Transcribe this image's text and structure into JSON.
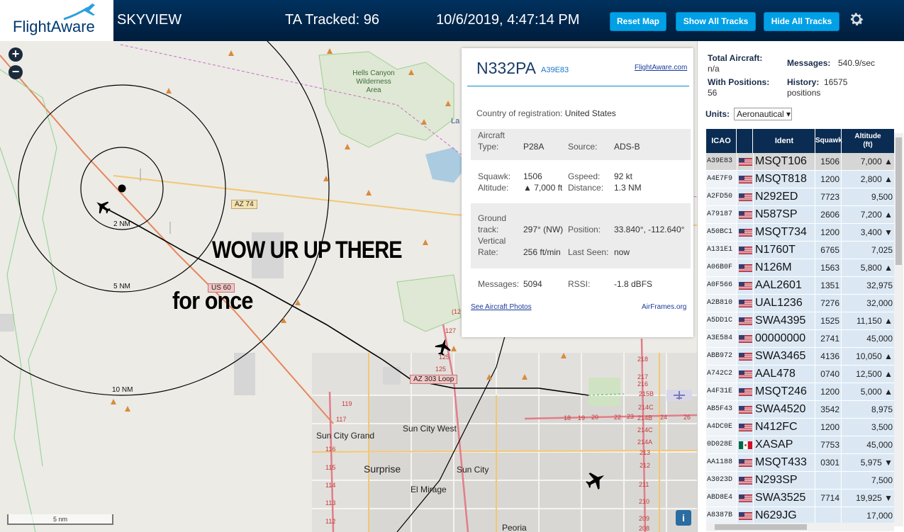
{
  "header": {
    "logo_text": "FlightAware",
    "title": "SKYVIEW",
    "tracked": "TA Tracked: 96",
    "datetime": "10/6/2019, 4:47:14 PM",
    "reset_label": "Reset Map",
    "show_label": "Show All Tracks",
    "hide_label": "Hide All Tracks",
    "settings_icon": "gear-icon"
  },
  "map": {
    "zoom_in": "+",
    "zoom_out": "−",
    "place_labels": {
      "hells_canyon": "Hells Canyon Wilderness Area",
      "lake": "La",
      "sun_city_grand": "Sun City Grand",
      "sun_city_west": "Sun City West",
      "surprise": "Surprise",
      "sun_city": "Sun City",
      "el_mirage": "El Mirage",
      "peoria": "Peoria"
    },
    "ring_labels": [
      "2 NM",
      "5 NM",
      "10 NM"
    ],
    "road_labels": {
      "az74": "AZ 74",
      "us60": "US 60",
      "az303": "AZ 303 Loop"
    },
    "highway_numbers": [
      "(12",
      "127",
      "125",
      "125",
      "119",
      "117",
      "116",
      "115",
      "114",
      "113",
      "112",
      "218",
      "217",
      "216",
      "215B",
      "214C",
      "214B",
      "214C",
      "214A",
      "213",
      "212",
      "211",
      "210",
      "209",
      "208",
      "18",
      "19",
      "20",
      "22",
      "23",
      "24",
      "26"
    ],
    "meme_line1": "WOW UR UP THERE",
    "meme_line2": "for once",
    "scale": "5 nm",
    "info": "i"
  },
  "detail": {
    "ident": "N332PA",
    "icao": "A39E83",
    "fa_link": "FlightAware.com",
    "country_label": "Country of registration:",
    "country_value": "United States",
    "aircraft_type_label1": "Aircraft",
    "aircraft_type_label2": "Type:",
    "aircraft_type": "P28A",
    "source_label": "Source:",
    "source": "ADS-B",
    "squawk_label": "Squawk:",
    "squawk": "1506",
    "altitude_label": "Altitude:",
    "altitude": "▲ 7,000 ft",
    "gspeed_label": "Gspeed:",
    "gspeed": "92 kt",
    "distance_label": "Distance:",
    "distance": "1.3 NM",
    "track_label1": "Ground",
    "track_label2": "track:",
    "track": "297° (NW)",
    "position_label": "Position:",
    "position": "33.840°, -112.640°",
    "vrate_label1": "Vertical",
    "vrate_label2": "Rate:",
    "vrate": "256 ft/min",
    "lastseen_label": "Last Seen:",
    "lastseen": "now",
    "messages_label": "Messages:",
    "messages": "5094",
    "rssi_label": "RSSI:",
    "rssi": "-1.8 dBFS",
    "photos_link": "See Aircraft Photos",
    "airframes_link": "AirFrames.org"
  },
  "stats": {
    "total_label": "Total Aircraft:",
    "total_value": "n/a",
    "messages_label": "Messages:",
    "messages_value": "540.9/sec",
    "positions_label": "With Positions:",
    "positions_value": "56",
    "history_label": "History:",
    "history_value": "16575",
    "history_unit": "positions",
    "units_label": "Units:",
    "units_value": "Aeronautical ▾"
  },
  "table": {
    "headers": {
      "icao": "ICAO",
      "ident": "Ident",
      "squawk": "Squawk",
      "alt1": "Altitude",
      "alt2": "(ft)"
    },
    "rows": [
      {
        "icao": "A39E83",
        "flag": "us",
        "ident": "MSQT106",
        "squawk": "1506",
        "alt": "7,000 ▲"
      },
      {
        "icao": "A4E7F9",
        "flag": "us",
        "ident": "MSQT818",
        "squawk": "1200",
        "alt": "2,800 ▲"
      },
      {
        "icao": "A2FD50",
        "flag": "us",
        "ident": "N292ED",
        "squawk": "7723",
        "alt": "9,500"
      },
      {
        "icao": "A79187",
        "flag": "us",
        "ident": "N587SP",
        "squawk": "2606",
        "alt": "7,200 ▲"
      },
      {
        "icao": "A50BC1",
        "flag": "us",
        "ident": "MSQT734",
        "squawk": "1200",
        "alt": "3,400 ▼"
      },
      {
        "icao": "A131E1",
        "flag": "us",
        "ident": "N1760T",
        "squawk": "6765",
        "alt": "7,025"
      },
      {
        "icao": "A06B0F",
        "flag": "us",
        "ident": "N126M",
        "squawk": "1563",
        "alt": "5,800 ▲"
      },
      {
        "icao": "A0F566",
        "flag": "us",
        "ident": "AAL2601",
        "squawk": "1351",
        "alt": "32,975"
      },
      {
        "icao": "A2B810",
        "flag": "us",
        "ident": "UAL1236",
        "squawk": "7276",
        "alt": "32,000"
      },
      {
        "icao": "A5DD1C",
        "flag": "us",
        "ident": "SWA4395",
        "squawk": "1525",
        "alt": "11,150 ▲"
      },
      {
        "icao": "A3E584",
        "flag": "us",
        "ident": "00000000",
        "squawk": "2741",
        "alt": "45,000"
      },
      {
        "icao": "ABB972",
        "flag": "us",
        "ident": "SWA3465",
        "squawk": "4136",
        "alt": "10,050 ▲"
      },
      {
        "icao": "A742C2",
        "flag": "us",
        "ident": "AAL478",
        "squawk": "0740",
        "alt": "12,500 ▲"
      },
      {
        "icao": "A4F31E",
        "flag": "us",
        "ident": "MSQT246",
        "squawk": "1200",
        "alt": "5,000 ▲"
      },
      {
        "icao": "AB5F43",
        "flag": "us",
        "ident": "SWA4520",
        "squawk": "3542",
        "alt": "8,975"
      },
      {
        "icao": "A4DC0E",
        "flag": "us",
        "ident": "N412FC",
        "squawk": "1200",
        "alt": "3,500"
      },
      {
        "icao": "0D028E",
        "flag": "mx",
        "ident": "XASAP",
        "squawk": "7753",
        "alt": "45,000"
      },
      {
        "icao": "AA1188",
        "flag": "us",
        "ident": "MSQT433",
        "squawk": "0301",
        "alt": "5,975 ▼"
      },
      {
        "icao": "A3023D",
        "flag": "us",
        "ident": "N293SP",
        "squawk": "",
        "alt": "7,500"
      },
      {
        "icao": "ABD8E4",
        "flag": "us",
        "ident": "SWA3525",
        "squawk": "7714",
        "alt": "19,925 ▼"
      },
      {
        "icao": "A8387B",
        "flag": "us",
        "ident": "N629JG",
        "squawk": "",
        "alt": "17,000"
      }
    ]
  }
}
